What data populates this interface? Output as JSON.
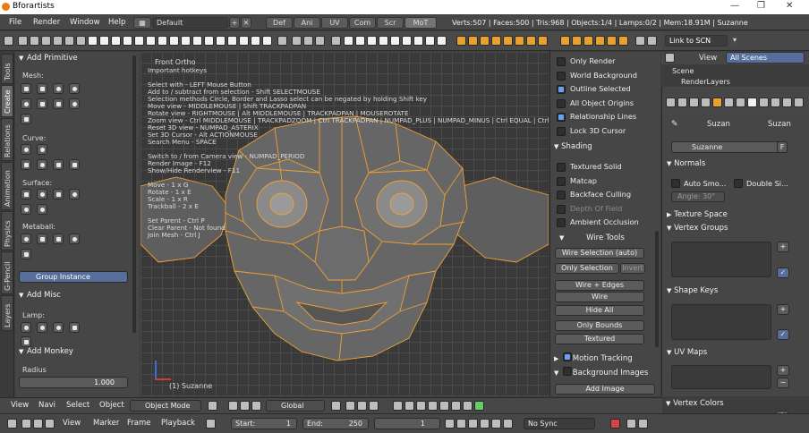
{
  "window": {
    "title": "Bforartists",
    "min": "—",
    "max": "❐",
    "close": "✕"
  },
  "info": {
    "menus": [
      "File",
      "Render",
      "Window",
      "Help"
    ],
    "layout": "Default",
    "screens": [
      "Def",
      "Ani",
      "UV",
      "Com",
      "Scr",
      "MoT"
    ],
    "active_screen": "MoT",
    "stats": "Verts:507 | Faces:500 | Tris:968 | Objects:1/4 | Lamps:0/2 | Mem:18.91M | Suzanne"
  },
  "props_top": {
    "link": "Link to SCN",
    "view_tab": "View",
    "scenes_dd": "All Scenes",
    "tree": [
      "Scene",
      "RenderLayers"
    ]
  },
  "tabs": [
    "Tools",
    "Create",
    "Relations",
    "Animation",
    "Physics",
    "G-Pencil",
    "Layers"
  ],
  "shelf": {
    "add_primitive": "Add Primitive",
    "mesh": "Mesh:",
    "curve": "Curve:",
    "surface": "Surface:",
    "metaball": "Metaball:",
    "group_instance": "Group Instance",
    "add_misc": "Add Misc",
    "lamp": "Lamp:",
    "add_monkey": "Add Monkey",
    "radius": "Radius",
    "radius_val": "1.000"
  },
  "viewport": {
    "view_name": "Front Ortho",
    "hotkeys": [
      "Important hotkeys",
      "",
      "Select with - LEFT Mouse Button",
      "Add to / subtract from selection - Shift SELECTMOUSE",
      "Selection methods Circle, Border and Lasso select can be negated by holding Shift key",
      "Move view - MIDDLEMOUSE | Shift TRACKPADPAN",
      "Rotate view - RIGHTMOUSE | Alt MIDDLEMOUSE | TRACKPADPAN | MOUSEROTATE",
      "Zoom view - Ctrl MIDDLEMOUSE | TRACKPADZOOM | Ctrl TRACKPADPAN | NUMPAD_PLUS | NUMPAD_MINUS | Ctrl EQUAL | Ctrl MI",
      "Reset 3D view - NUMPAD_ASTERIX",
      "Set 3D Cursor - Alt ACTIONMOUSE",
      "Search Menu - SPACE",
      "",
      "Switch to / from Camera view - NUMPAD_PERIOD",
      "Render Image - F12",
      "Show/Hide Renderview - F11",
      "",
      "Move - 1 x G",
      "Rotate - 1 x E",
      "Scale - 1 x R",
      "Trackball - 2 x E",
      "",
      "Set Parent - Ctrl P",
      "Clear Parent - Not found",
      "Join Mesh - Ctrl J"
    ],
    "object_label": "(1) Suzanne"
  },
  "npanel": {
    "display": [
      {
        "label": "Only Render",
        "on": false
      },
      {
        "label": "World Background",
        "on": false
      },
      {
        "label": "Outline Selected",
        "on": true
      },
      {
        "label": "All Object Origins",
        "on": false
      },
      {
        "label": "Relationship Lines",
        "on": true
      },
      {
        "label": "Lock 3D Cursor",
        "on": false
      }
    ],
    "shading": "Shading",
    "shading_opts": [
      {
        "label": "Textured Solid",
        "on": false,
        "dim": false
      },
      {
        "label": "Matcap",
        "on": false,
        "dim": false
      },
      {
        "label": "Backface Culling",
        "on": false,
        "dim": false
      },
      {
        "label": "Depth Of Field",
        "on": false,
        "dim": true
      },
      {
        "label": "Ambient Occlusion",
        "on": false,
        "dim": false
      }
    ],
    "wire_tools": "Wire Tools",
    "wire_sel": "Wire Selection (auto)",
    "only_sel": "Only Selection",
    "invert": "Invert",
    "wire_edges": "Wire + Edges",
    "wire": "Wire",
    "hide_all": "Hide All",
    "only_bounds": "Only Bounds",
    "textured": "Textured",
    "motion": "Motion Tracking",
    "bg_images": "Background Images",
    "add_image": "Add Image"
  },
  "props": {
    "obj1": "Suzan",
    "obj2": "Suzan",
    "name": "Suzanne",
    "f": "F",
    "normals": "Normals",
    "auto_smooth": "Auto Smo...",
    "double_sided": "Double Si...",
    "angle": "Angle:",
    "angle_val": "30°",
    "texture_space": "Texture Space",
    "vertex_groups": "Vertex Groups",
    "shape_keys": "Shape Keys",
    "uv_maps": "UV Maps",
    "vertex_colors": "Vertex Colors"
  },
  "vphdr": {
    "menus": [
      "View",
      "Navi",
      "Select",
      "Object"
    ],
    "mode": "Object Mode",
    "orientation": "Global"
  },
  "timeline": {
    "menus": [
      "View",
      "Marker",
      "Frame",
      "Playback"
    ],
    "start_label": "Start:",
    "start": "1",
    "end_label": "End:",
    "end": "250",
    "current": "1",
    "sync": "No Sync"
  }
}
